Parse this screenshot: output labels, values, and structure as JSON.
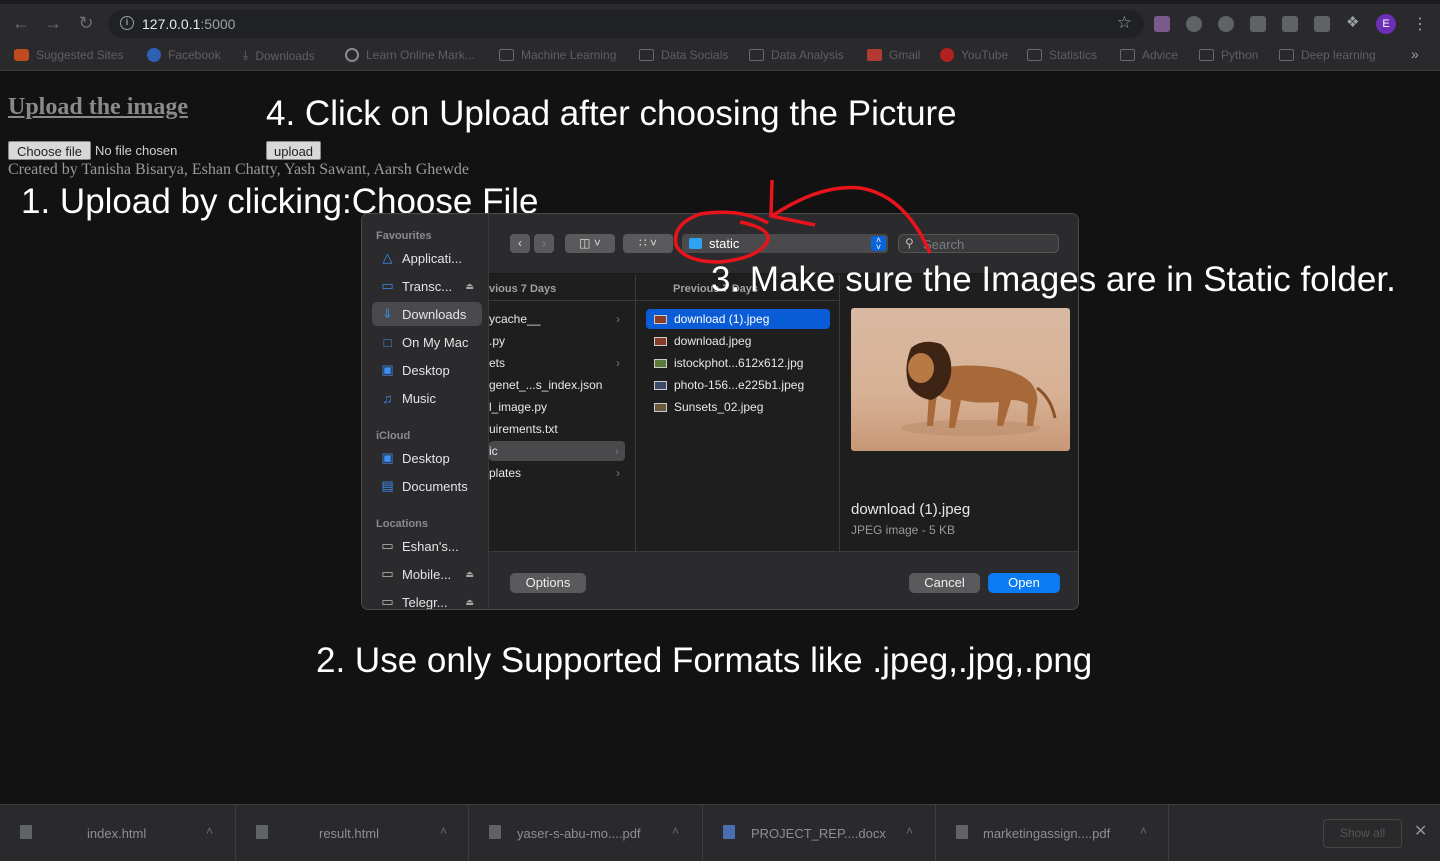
{
  "browser": {
    "url_host": "127.0.0.1",
    "url_port": ":5000",
    "profile_initial": "E",
    "bookmarks": [
      {
        "label": "Suggested Sites",
        "icon": "suggested-sites-icon"
      },
      {
        "label": "Facebook",
        "icon": "facebook-icon"
      },
      {
        "label": "Downloads",
        "icon": "download-icon"
      },
      {
        "label": "Learn Online Mark...",
        "icon": "google-icon"
      },
      {
        "label": "Machine Learning",
        "icon": "folder-icon"
      },
      {
        "label": "Data Socials",
        "icon": "folder-icon"
      },
      {
        "label": "Data Analysis",
        "icon": "folder-icon"
      },
      {
        "label": "Gmail",
        "icon": "gmail-icon"
      },
      {
        "label": "YouTube",
        "icon": "youtube-icon"
      },
      {
        "label": "Statistics",
        "icon": "folder-icon"
      },
      {
        "label": "Advice",
        "icon": "folder-icon"
      },
      {
        "label": "Python",
        "icon": "folder-icon"
      },
      {
        "label": "Deep learning",
        "icon": "folder-icon"
      }
    ],
    "bookmarks_overflow": "»"
  },
  "page": {
    "heading": "Upload the image",
    "choose_file_label": "Choose file",
    "no_file_text": "No file chosen",
    "upload_label": "upload",
    "credits": "Created by Tanisha Bisarya, Eshan Chatty, Yash Sawant, Aarsh Ghewde"
  },
  "annotations": {
    "step1": "1. Upload by clicking:Choose File",
    "step2": "2. Use only Supported Formats like .jpeg,.jpg,.png",
    "step3": "3. Make sure the Images are in Static folder.",
    "step4": "4. Click on Upload after choosing the Picture",
    "highlight_color": "#e8141b"
  },
  "dialog": {
    "sidebar": {
      "favourites_heading": "Favourites",
      "favourites": [
        {
          "label": "Applicati...",
          "icon": "applications-icon",
          "selected": false
        },
        {
          "label": "Transc...",
          "icon": "drive-icon",
          "selected": false,
          "eject": true
        },
        {
          "label": "Downloads",
          "icon": "downloads-icon",
          "selected": true
        },
        {
          "label": "On My Mac",
          "icon": "folder-icon",
          "selected": false
        },
        {
          "label": "Desktop",
          "icon": "desktop-icon",
          "selected": false
        },
        {
          "label": "Music",
          "icon": "music-icon",
          "selected": false
        }
      ],
      "icloud_heading": "iCloud",
      "icloud": [
        {
          "label": "Desktop",
          "icon": "desktop-icon"
        },
        {
          "label": "Documents",
          "icon": "document-icon"
        }
      ],
      "locations_heading": "Locations",
      "locations": [
        {
          "label": "Eshan's...",
          "icon": "laptop-icon",
          "eject": false
        },
        {
          "label": "Mobile...",
          "icon": "drive-icon",
          "eject": true
        },
        {
          "label": "Telegr...",
          "icon": "drive-icon",
          "eject": true
        }
      ]
    },
    "location": "static",
    "search_placeholder": "Search",
    "column1": {
      "header": "vious 7 Days",
      "items": [
        {
          "label": "ycache__",
          "chevron": true,
          "state": "normal"
        },
        {
          "label": ".py",
          "chevron": false,
          "state": "normal"
        },
        {
          "label": "ets",
          "chevron": true,
          "state": "normal"
        },
        {
          "label": "genet_...s_index.json",
          "chevron": false,
          "state": "normal"
        },
        {
          "label": "l_image.py",
          "chevron": false,
          "state": "normal"
        },
        {
          "label": "uirements.txt",
          "chevron": false,
          "state": "normal"
        },
        {
          "label": "ic",
          "chevron": true,
          "state": "inactive-selected"
        },
        {
          "label": "plates",
          "chevron": true,
          "state": "normal"
        }
      ]
    },
    "column2": {
      "header": "Previous 7 Days",
      "items": [
        {
          "label": "download (1).jpeg",
          "selected": true
        },
        {
          "label": "download.jpeg",
          "selected": false
        },
        {
          "label": "istockphot...612x612.jpg",
          "selected": false
        },
        {
          "label": "photo-156...e225b1.jpeg",
          "selected": false
        },
        {
          "label": "Sunsets_02.jpeg",
          "selected": false
        }
      ]
    },
    "preview": {
      "image": "lion-walking-photo",
      "name": "download (1).jpeg",
      "meta": "JPEG image - 5 KB"
    },
    "options_label": "Options",
    "cancel_label": "Cancel",
    "open_label": "Open"
  },
  "downloads_shelf": {
    "items": [
      {
        "label": "index.html",
        "icon": "html-file-icon"
      },
      {
        "label": "result.html",
        "icon": "html-file-icon"
      },
      {
        "label": "yaser-s-abu-mo....pdf",
        "icon": "pdf-file-icon"
      },
      {
        "label": "PROJECT_REP....docx",
        "icon": "word-file-icon"
      },
      {
        "label": "marketingassign....pdf",
        "icon": "pdf-file-icon"
      }
    ],
    "show_all_label": "Show all"
  }
}
